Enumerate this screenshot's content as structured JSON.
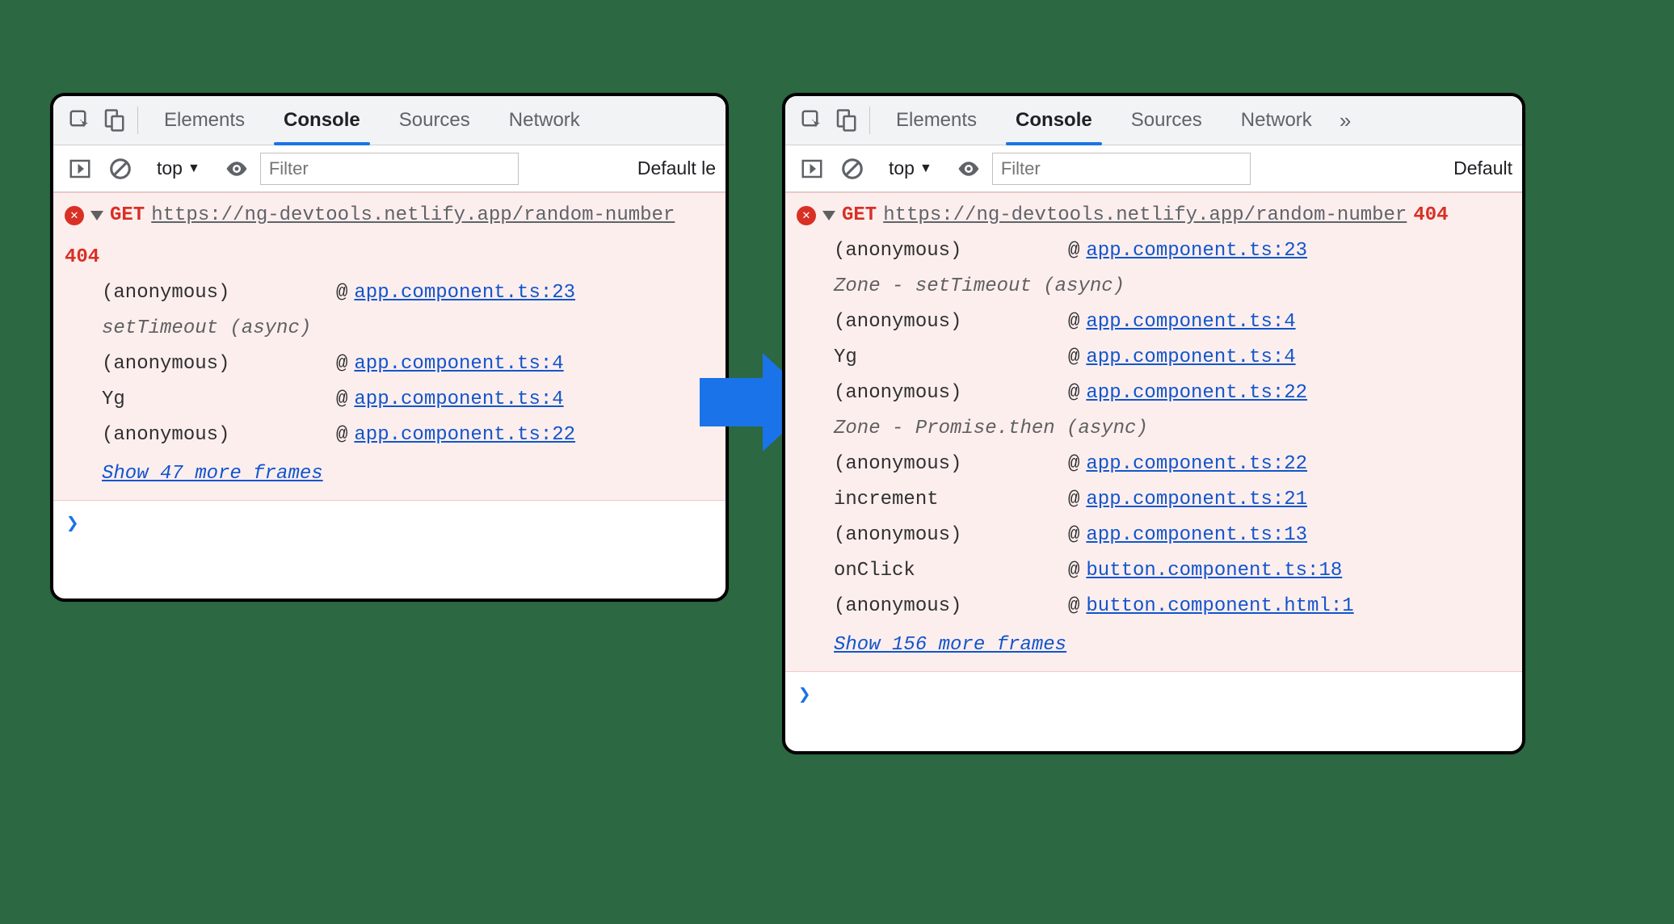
{
  "tabs": {
    "elements": "Elements",
    "console": "Console",
    "sources": "Sources",
    "network": "Network"
  },
  "toolbar": {
    "context": "top",
    "filter_placeholder": "Filter",
    "levels_left": "Default le",
    "levels_right": "Default"
  },
  "left": {
    "method": "GET",
    "url": "https://ng-devtools.netlify.app/random-number",
    "status": "404",
    "stack": [
      {
        "fn": "(anonymous)",
        "src": "app.component.ts:23"
      },
      {
        "group": "setTimeout (async)"
      },
      {
        "fn": "(anonymous)",
        "src": "app.component.ts:4"
      },
      {
        "fn": "Yg",
        "src": "app.component.ts:4"
      },
      {
        "fn": "(anonymous)",
        "src": "app.component.ts:22"
      }
    ],
    "show_more": "Show 47 more frames"
  },
  "right": {
    "method": "GET",
    "url": "https://ng-devtools.netlify.app/random-number",
    "status": "404",
    "stack": [
      {
        "fn": "(anonymous)",
        "src": "app.component.ts:23"
      },
      {
        "group": "Zone - setTimeout (async)"
      },
      {
        "fn": "(anonymous)",
        "src": "app.component.ts:4"
      },
      {
        "fn": "Yg",
        "src": "app.component.ts:4"
      },
      {
        "fn": "(anonymous)",
        "src": "app.component.ts:22"
      },
      {
        "group": "Zone - Promise.then (async)"
      },
      {
        "fn": "(anonymous)",
        "src": "app.component.ts:22"
      },
      {
        "fn": "increment",
        "src": "app.component.ts:21"
      },
      {
        "fn": "(anonymous)",
        "src": "app.component.ts:13"
      },
      {
        "fn": "onClick",
        "src": "button.component.ts:18"
      },
      {
        "fn": "(anonymous)",
        "src": "button.component.html:1"
      }
    ],
    "show_more": "Show 156 more frames"
  },
  "prompt": "❯",
  "more_glyph": "»"
}
